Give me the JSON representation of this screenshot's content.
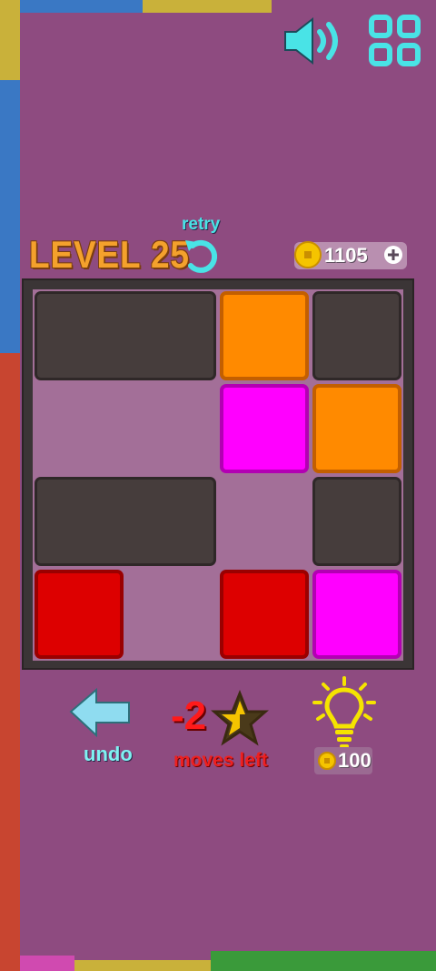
{
  "header": {
    "level_title": "LEVEL 25",
    "retry_label": "retry",
    "coins": "1105"
  },
  "board": {
    "rows": 4,
    "cols": 4,
    "blocks": [
      {
        "type": "wall",
        "row": 0,
        "col": 0,
        "colspan": 2
      },
      {
        "type": "orange",
        "row": 0,
        "col": 2,
        "colspan": 1
      },
      {
        "type": "wall",
        "row": 0,
        "col": 3,
        "colspan": 1
      },
      {
        "type": "magenta",
        "row": 1,
        "col": 2,
        "colspan": 1
      },
      {
        "type": "orange",
        "row": 1,
        "col": 3,
        "colspan": 1
      },
      {
        "type": "wall",
        "row": 2,
        "col": 0,
        "colspan": 2
      },
      {
        "type": "wall",
        "row": 2,
        "col": 3,
        "colspan": 1
      },
      {
        "type": "red",
        "row": 3,
        "col": 0,
        "colspan": 1
      },
      {
        "type": "red",
        "row": 3,
        "col": 2,
        "colspan": 1
      },
      {
        "type": "magenta",
        "row": 3,
        "col": 3,
        "colspan": 1
      }
    ]
  },
  "footer": {
    "undo_label": "undo",
    "moves_count": "-2",
    "moves_label": "moves left",
    "hint_price": "100"
  },
  "colors": {
    "background": "#8e4b80",
    "orange": "#ff8a00",
    "magenta": "#ff00ff",
    "red": "#dd0000",
    "wall": "#463d3c",
    "accent": "#49e3e6"
  }
}
